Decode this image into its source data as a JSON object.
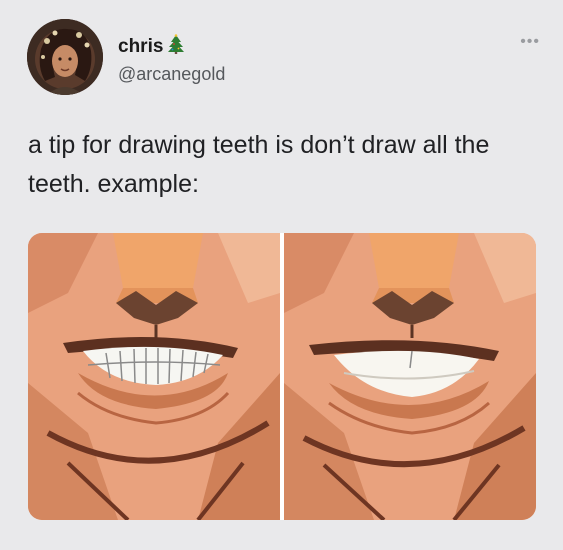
{
  "author": {
    "display_name": "chris",
    "badge_icon": "christmas-tree-icon",
    "handle": "@arcanegold"
  },
  "tweet": {
    "text": "a tip for drawing teeth is don’t draw all the teeth. example:"
  },
  "media": {
    "images": [
      {
        "description_icon": "teeth-all-drawn-image"
      },
      {
        "description_icon": "teeth-simplified-image"
      }
    ]
  },
  "colors": {
    "background": "#e9e9eb",
    "text": "#202124",
    "handle": "#55585c",
    "skin": "#e7a27c",
    "shadow": "#7a3f2a"
  }
}
